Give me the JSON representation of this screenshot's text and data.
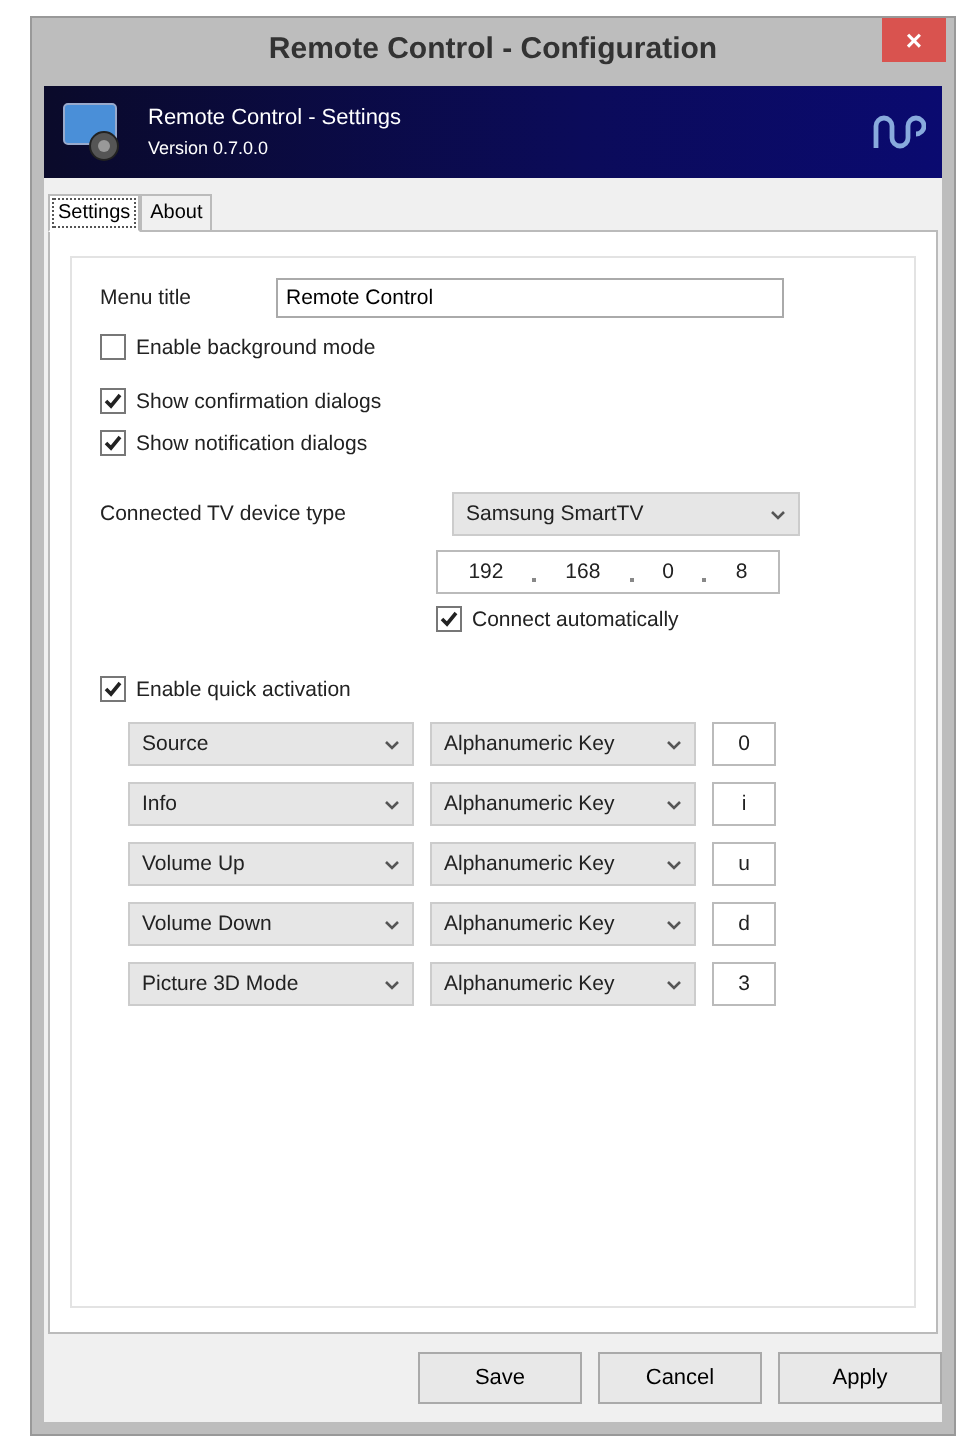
{
  "window": {
    "title": "Remote Control - Configuration",
    "close": "×"
  },
  "header": {
    "title": "Remote Control - Settings",
    "version": "Version 0.7.0.0"
  },
  "tabs": [
    {
      "label": "Settings",
      "selected": true
    },
    {
      "label": "About",
      "selected": false
    }
  ],
  "menu_title": {
    "label": "Menu title",
    "value": "Remote Control"
  },
  "options": [
    {
      "label": "Enable background mode",
      "checked": false
    },
    {
      "label": "Show confirmation dialogs",
      "checked": true
    },
    {
      "label": "Show notification dialogs",
      "checked": true
    }
  ],
  "device": {
    "label": "Connected TV device type",
    "value": "Samsung SmartTV",
    "ip": [
      "192",
      "168",
      "0",
      "8"
    ],
    "connect": {
      "label": "Connect automatically",
      "checked": true
    }
  },
  "quick_activation": {
    "label": "Enable quick activation",
    "checked": true,
    "rows": [
      {
        "action": "Source",
        "key_type": "Alphanumeric Key",
        "key": "0"
      },
      {
        "action": "Info",
        "key_type": "Alphanumeric Key",
        "key": "i"
      },
      {
        "action": "Volume Up",
        "key_type": "Alphanumeric Key",
        "key": "u"
      },
      {
        "action": "Volume Down",
        "key_type": "Alphanumeric Key",
        "key": "d"
      },
      {
        "action": "Picture 3D Mode",
        "key_type": "Alphanumeric Key",
        "key": "3"
      }
    ]
  },
  "buttons": [
    "Save",
    "Cancel",
    "Apply"
  ]
}
